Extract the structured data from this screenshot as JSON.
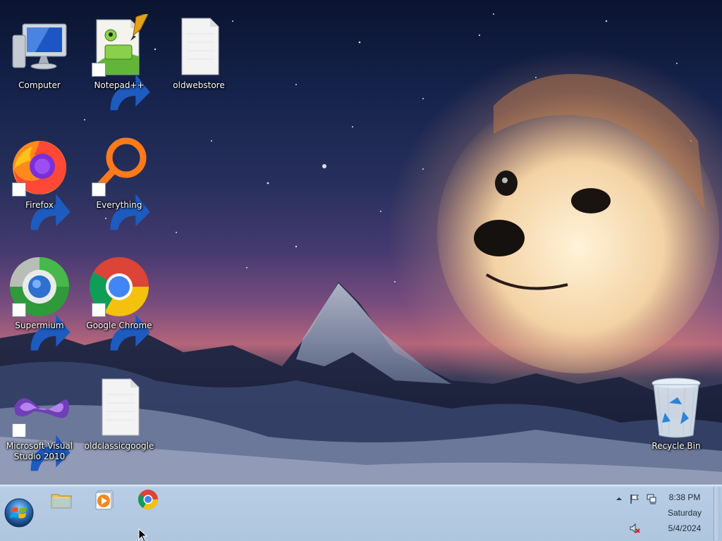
{
  "desktop": {
    "icons": [
      {
        "label": "Computer",
        "icon": "computer-icon"
      },
      {
        "label": "Notepad++",
        "icon": "notepadpp-icon"
      },
      {
        "label": "oldwebstore",
        "icon": "file-icon"
      },
      {
        "label": "Firefox",
        "icon": "firefox-icon"
      },
      {
        "label": "Everything",
        "icon": "everything-search-icon"
      },
      {
        "label": "Supermium",
        "icon": "supermium-icon"
      },
      {
        "label": "Google Chrome",
        "icon": "chrome-icon"
      },
      {
        "label": "Microsoft Visual Studio 2010",
        "icon": "visual-studio-icon"
      },
      {
        "label": "oldclassicgoogle",
        "icon": "file-icon"
      },
      {
        "label": "Recycle Bin",
        "icon": "recycle-bin-icon"
      }
    ]
  },
  "taskbar": {
    "start_icon": "windows-start-orb-icon",
    "pinned": [
      {
        "icon": "file-explorer-icon"
      },
      {
        "icon": "media-player-icon"
      },
      {
        "icon": "chrome-icon"
      }
    ],
    "tray": {
      "icons": [
        "show-hidden-icons-chevron",
        "action-center-flag-icon",
        "network-icon",
        "volume-muted-icon"
      ],
      "time": "8:38 PM",
      "day": "Saturday",
      "date": "5/4/2024"
    }
  },
  "colors": {
    "taskbar_bg": "#afc6df",
    "label_text": "#ffffff"
  }
}
